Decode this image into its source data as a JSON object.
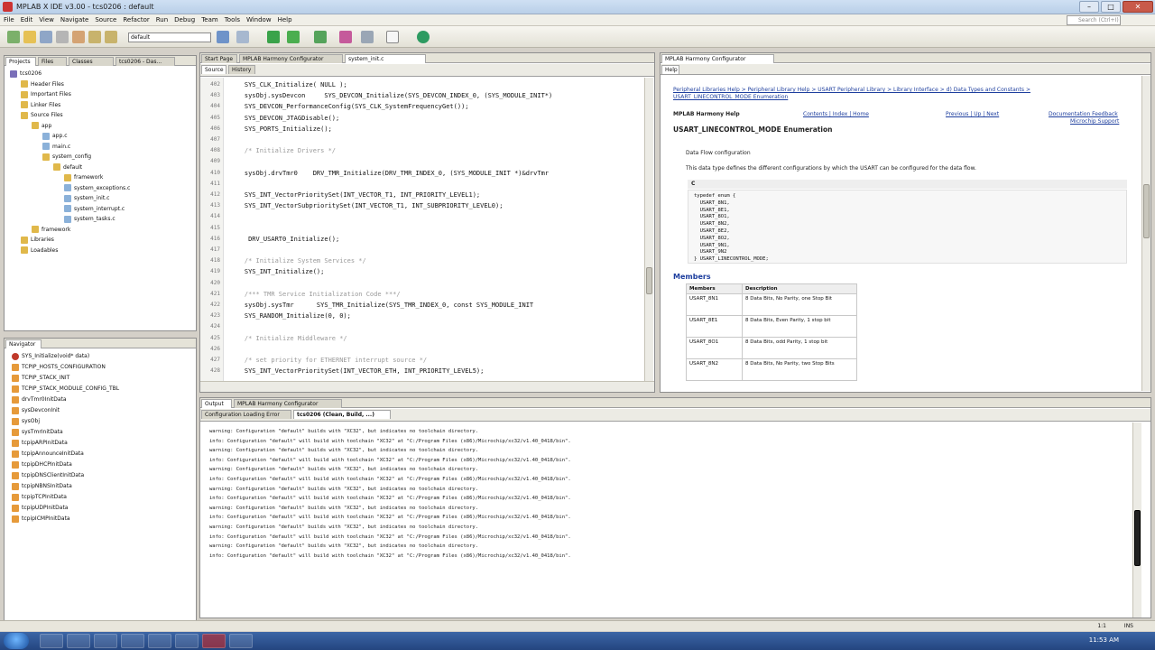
{
  "window": {
    "title": "MPLAB X IDE v3.00 - tcs0206 : default"
  },
  "menu": [
    "File",
    "Edit",
    "View",
    "Navigate",
    "Source",
    "Refactor",
    "Run",
    "Debug",
    "Team",
    "Tools",
    "Window",
    "Help"
  ],
  "search_placeholder": "Search (Ctrl+I)",
  "toolbar": {
    "config": "default"
  },
  "projects": {
    "tabs": [
      "Projects",
      "Files",
      "Classes",
      "tcs0206 - Das..."
    ],
    "tree": [
      {
        "label": "tcs0206",
        "depth": 0
      },
      {
        "label": "Header Files",
        "depth": 1
      },
      {
        "label": "Important Files",
        "depth": 1
      },
      {
        "label": "Linker Files",
        "depth": 1
      },
      {
        "label": "Source Files",
        "depth": 1
      },
      {
        "label": "app",
        "depth": 2
      },
      {
        "label": "app.c",
        "depth": 3
      },
      {
        "label": "main.c",
        "depth": 3
      },
      {
        "label": "system_config",
        "depth": 3
      },
      {
        "label": "default",
        "depth": 4
      },
      {
        "label": "framework",
        "depth": 5
      },
      {
        "label": "system_exceptions.c",
        "depth": 5
      },
      {
        "label": "system_init.c",
        "depth": 5
      },
      {
        "label": "system_interrupt.c",
        "depth": 5
      },
      {
        "label": "system_tasks.c",
        "depth": 5
      },
      {
        "label": "framework",
        "depth": 2
      },
      {
        "label": "Libraries",
        "depth": 1
      },
      {
        "label": "Loadables",
        "depth": 1
      }
    ]
  },
  "navigator": {
    "title": "Navigator",
    "items": [
      "SYS_Initialize(void* data)",
      "TCPIP_HOSTS_CONFIGURATION",
      "TCPIP_STACK_INIT",
      "TCPIP_STACK_MODULE_CONFIG_TBL",
      "drvTmr0InitData",
      "sysDevconInit",
      "sysObj",
      "sysTmrInitData",
      "tcpipARPInitData",
      "tcpipAnnounceInitData",
      "tcpipDHCPInitData",
      "tcpipDNSClientInitData",
      "tcpipNBNSInitData",
      "tcpipTCPInitData",
      "tcpipUDPInitData",
      "tcpipICMPInitData"
    ]
  },
  "editor": {
    "tabs": [
      "Start Page",
      "MPLAB Harmony Configurator",
      "system_init.c"
    ],
    "subtabs": [
      "Source",
      "History"
    ],
    "lines": [
      {
        "n": "402",
        "t": "    SYS_CLK_Initialize( NULL );",
        "c": "normal"
      },
      {
        "n": "403",
        "t": "    sysObj.sysDevcon     SYS_DEVCON_Initialize(SYS_DEVCON_INDEX_0, (SYS_MODULE_INIT*)",
        "c": "normal"
      },
      {
        "n": "404",
        "t": "    SYS_DEVCON_PerformanceConfig(SYS_CLK_SystemFrequencyGet());",
        "c": "normal"
      },
      {
        "n": "405",
        "t": "    SYS_DEVCON_JTAGDisable();",
        "c": "normal"
      },
      {
        "n": "406",
        "t": "    SYS_PORTS_Initialize();",
        "c": "normal"
      },
      {
        "n": "407",
        "t": "",
        "c": "normal"
      },
      {
        "n": "408",
        "t": "    /* Initialize Drivers */",
        "c": "comment"
      },
      {
        "n": "409",
        "t": "",
        "c": "normal"
      },
      {
        "n": "410",
        "t": "    sysObj.drvTmr0    DRV_TMR_Initialize(DRV_TMR_INDEX_0, (SYS_MODULE_INIT *)&drvTmr",
        "c": "normal"
      },
      {
        "n": "411",
        "t": "",
        "c": "normal"
      },
      {
        "n": "412",
        "t": "    SYS_INT_VectorPrioritySet(INT_VECTOR_T1, INT_PRIORITY_LEVEL1);",
        "c": "normal"
      },
      {
        "n": "413",
        "t": "    SYS_INT_VectorSubprioritySet(INT_VECTOR_T1, INT_SUBPRIORITY_LEVEL0);",
        "c": "normal"
      },
      {
        "n": "414",
        "t": "",
        "c": "normal"
      },
      {
        "n": "415",
        "t": "",
        "c": "normal"
      },
      {
        "n": "416",
        "t": "     DRV_USART0_Initialize();",
        "c": "normal"
      },
      {
        "n": "417",
        "t": "",
        "c": "normal"
      },
      {
        "n": "418",
        "t": "    /* Initialize System Services */",
        "c": "comment"
      },
      {
        "n": "419",
        "t": "    SYS_INT_Initialize();",
        "c": "normal"
      },
      {
        "n": "420",
        "t": "",
        "c": "normal"
      },
      {
        "n": "421",
        "t": "    /*** TMR Service Initialization Code ***/",
        "c": "comment"
      },
      {
        "n": "422",
        "t": "    sysObj.sysTmr      SYS_TMR_Initialize(SYS_TMR_INDEX_0, const SYS_MODULE_INIT",
        "c": "normal"
      },
      {
        "n": "423",
        "t": "    SYS_RANDOM_Initialize(0, 0);",
        "c": "normal"
      },
      {
        "n": "424",
        "t": "",
        "c": "normal"
      },
      {
        "n": "425",
        "t": "    /* Initialize Middleware */",
        "c": "comment"
      },
      {
        "n": "426",
        "t": "",
        "c": "normal"
      },
      {
        "n": "427",
        "t": "    /* set priority for ETHERNET interrupt source */",
        "c": "comment"
      },
      {
        "n": "428",
        "t": "    SYS_INT_VectorPrioritySet(INT_VECTOR_ETH, INT_PRIORITY_LEVEL5);",
        "c": "normal"
      }
    ]
  },
  "help": {
    "panel_title": "MPLAB Harmony Configurator",
    "tab": "Help",
    "breadcrumb": "Peripheral Libraries Help > Peripheral Library Help > USART Peripheral Library > Library Interface > d) Data Types and Constants >",
    "crumb2": "USART_LINECONTROL_MODE Enumeration",
    "nav_left": "MPLAB Harmony Help",
    "nav_links": [
      "Contents | Index | Home",
      "Previous | Up | Next",
      "Documentation Feedback"
    ],
    "nav_right2": "Microchip Support",
    "heading": "USART_LINECONTROL_MODE Enumeration",
    "sub": "Data Flow configuration",
    "desc": "This data type defines the different configurations by which the USART can be configured for the data flow.",
    "c_label": "C",
    "code": [
      "typedef enum {",
      "  USART_8N1,",
      "  USART_8E1,",
      "  USART_8O1,",
      "  USART_8N2,",
      "  USART_8E2,",
      "  USART_8O2,",
      "  USART_9N1,",
      "  USART_9N2",
      "} USART_LINECONTROL_MODE;"
    ],
    "members_title": "Members",
    "members_head": [
      "Members",
      "Description"
    ],
    "members": [
      [
        "USART_8N1",
        "8 Data Bits, No Parity, one Stop Bit"
      ],
      [
        "USART_8E1",
        "8 Data Bits, Even Parity, 1 stop bit"
      ],
      [
        "USART_8O1",
        "8 Data Bits, odd Parity, 1 stop bit"
      ],
      [
        "USART_8N2",
        "8 Data Bits, No Parity, two Stop Bits"
      ]
    ]
  },
  "output": {
    "tabs": [
      "Output",
      "MPLAB Harmony Configurator"
    ],
    "subtabs": [
      "Configuration Loading Error",
      "tcs0206 (Clean, Build, ...)"
    ],
    "lines": [
      "warning: Configuration \"default\" builds with \"XC32\", but indicates no toolchain directory.",
      "info: Configuration \"default\" will build with toolchain \"XC32\" at \"C:/Program Files (x86)/Microchip/xc32/v1.40_0418/bin\".",
      "warning: Configuration \"default\" builds with \"XC32\", but indicates no toolchain directory.",
      "info: Configuration \"default\" will build with toolchain \"XC32\" at \"C:/Program Files (x86)/Microchip/xc32/v1.40_0418/bin\".",
      "warning: Configuration \"default\" builds with \"XC32\", but indicates no toolchain directory.",
      "info: Configuration \"default\" will build with toolchain \"XC32\" at \"C:/Program Files (x86)/Microchip/xc32/v1.40_0418/bin\".",
      "warning: Configuration \"default\" builds with \"XC32\", but indicates no toolchain directory.",
      "info: Configuration \"default\" will build with toolchain \"XC32\" at \"C:/Program Files (x86)/Microchip/xc32/v1.40_0418/bin\".",
      "warning: Configuration \"default\" builds with \"XC32\", but indicates no toolchain directory.",
      "info: Configuration \"default\" will build with toolchain \"XC32\" at \"C:/Program Files (x86)/Microchip/xc32/v1.40_0418/bin\".",
      "warning: Configuration \"default\" builds with \"XC32\", but indicates no toolchain directory.",
      "info: Configuration \"default\" will build with toolchain \"XC32\" at \"C:/Program Files (x86)/Microchip/xc32/v1.40_0418/bin\".",
      "warning: Configuration \"default\" builds with \"XC32\", but indicates no toolchain directory.",
      "info: Configuration \"default\" will build with toolchain \"XC32\" at \"C:/Program Files (x86)/Microchip/xc32/v1.40_0418/bin\"."
    ]
  },
  "statusbar": {
    "position": "1:1",
    "mode": "INS"
  },
  "taskbar": {
    "clock": "11:53 AM"
  }
}
